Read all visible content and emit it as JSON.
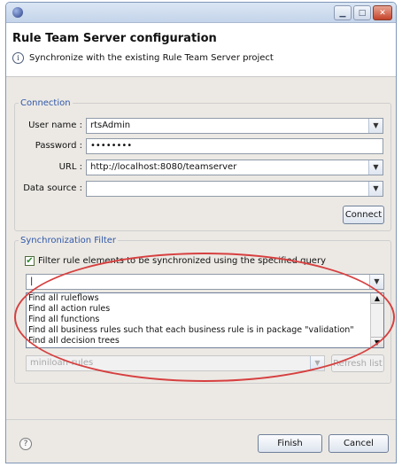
{
  "dialog": {
    "window_title": "",
    "title": "Rule Team Server configuration",
    "message": "Synchronize with the existing Rule Team Server project"
  },
  "connection": {
    "legend": "Connection",
    "username_label": "User name :",
    "username_value": "rtsAdmin",
    "password_label": "Password :",
    "password_value": "••••••••",
    "url_label": "URL :",
    "url_value": "http://localhost:8080/teamserver",
    "datasource_label": "Data source :",
    "datasource_value": "",
    "connect_label": "Connect"
  },
  "sync": {
    "legend": "Synchronization Filter",
    "filter_checked": true,
    "filter_label": "Filter rule elements to be synchronized using the specified query",
    "query_value": "|",
    "query_options": [
      "Find all ruleflows",
      "Find all action rules",
      "Find all functions",
      "Find all business rules  such that each business rule is in package \"validation\"",
      "Find all decision trees"
    ],
    "project_value": "miniloan-rules",
    "refresh_label": "Refresh list"
  },
  "footer": {
    "finish_label": "Finish",
    "cancel_label": "Cancel"
  },
  "icons": {
    "window_app": "eclipse-icon",
    "info": "info-icon",
    "help": "help-icon"
  },
  "colors": {
    "legend_blue": "#2f57a8",
    "annotation_red": "#d64040",
    "checkmark_green": "#2e8a2e"
  }
}
